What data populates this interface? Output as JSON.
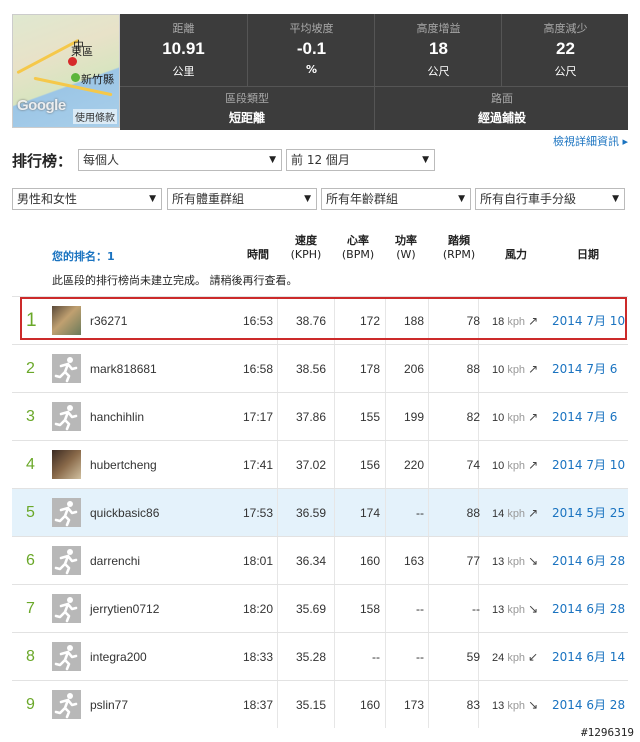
{
  "map": {
    "city1": "東區",
    "city2": "新竹縣",
    "edge_label": "中",
    "brand": "Google",
    "terms": "使用條款"
  },
  "stats": {
    "distance": {
      "label": "距離",
      "value": "10.91",
      "unit": "公里"
    },
    "grade": {
      "label": "平均坡度",
      "value": "-0.1",
      "unit": "%"
    },
    "gain": {
      "label": "高度增益",
      "value": "18",
      "unit": "公尺"
    },
    "loss": {
      "label": "高度減少",
      "value": "22",
      "unit": "公尺"
    },
    "type": {
      "label": "區段類型",
      "value": "短距離"
    },
    "surface": {
      "label": "路面",
      "value": "經過鋪設"
    }
  },
  "detail_link": "檢視詳細資訊 ▸",
  "leaderboard": {
    "title": "排行榜：",
    "filter_who": "每個人",
    "filter_period": "前 12 個月",
    "filter_gender": "男性和女性",
    "filter_weight": "所有體重群組",
    "filter_age": "所有年齡群組",
    "filter_class": "所有自行車手分級"
  },
  "table": {
    "your_rank": "您的排名：1",
    "note": "此區段的排行榜尚未建立完成。 請稍後再行查看。",
    "headers": {
      "time": "時間",
      "speed": "速度",
      "speed_unit": "(KPH)",
      "hr": "心率",
      "hr_unit": "(BPM)",
      "power": "功率",
      "power_unit": "(W)",
      "cadence": "踏頻",
      "cadence_unit": "(RPM)",
      "wind": "風力",
      "date": "日期"
    },
    "rows": [
      {
        "rank": "1",
        "name": "r36271",
        "time": "16:53",
        "speed": "38.76",
        "hr": "172",
        "power": "188",
        "cadence": "78",
        "wind": "18",
        "wind_unit": "kph",
        "wind_dir": "↗",
        "date": "2014 7月 10"
      },
      {
        "rank": "2",
        "name": "mark818681",
        "time": "16:58",
        "speed": "38.56",
        "hr": "178",
        "power": "206",
        "cadence": "88",
        "wind": "10",
        "wind_unit": "kph",
        "wind_dir": "↗",
        "date": "2014 7月 6"
      },
      {
        "rank": "3",
        "name": "hanchihlin",
        "time": "17:17",
        "speed": "37.86",
        "hr": "155",
        "power": "199",
        "cadence": "82",
        "wind": "10",
        "wind_unit": "kph",
        "wind_dir": "↗",
        "date": "2014 7月 6"
      },
      {
        "rank": "4",
        "name": "hubertcheng",
        "time": "17:41",
        "speed": "37.02",
        "hr": "156",
        "power": "220",
        "cadence": "74",
        "wind": "10",
        "wind_unit": "kph",
        "wind_dir": "↗",
        "date": "2014 7月 10"
      },
      {
        "rank": "5",
        "name": "quickbasic86",
        "time": "17:53",
        "speed": "36.59",
        "hr": "174",
        "power": "--",
        "cadence": "88",
        "wind": "14",
        "wind_unit": "kph",
        "wind_dir": "↗",
        "date": "2014 5月 25"
      },
      {
        "rank": "6",
        "name": "darrenchi",
        "time": "18:01",
        "speed": "36.34",
        "hr": "160",
        "power": "163",
        "cadence": "77",
        "wind": "13",
        "wind_unit": "kph",
        "wind_dir": "↘",
        "date": "2014 6月 28"
      },
      {
        "rank": "7",
        "name": "jerrytien0712",
        "time": "18:20",
        "speed": "35.69",
        "hr": "158",
        "power": "--",
        "cadence": "--",
        "wind": "13",
        "wind_unit": "kph",
        "wind_dir": "↘",
        "date": "2014 6月 28"
      },
      {
        "rank": "8",
        "name": "integra200",
        "time": "18:33",
        "speed": "35.28",
        "hr": "--",
        "power": "--",
        "cadence": "59",
        "wind": "24",
        "wind_unit": "kph",
        "wind_dir": "↙",
        "date": "2014 6月 14"
      },
      {
        "rank": "9",
        "name": "pslin77",
        "time": "18:37",
        "speed": "35.15",
        "hr": "160",
        "power": "173",
        "cadence": "83",
        "wind": "13",
        "wind_unit": "kph",
        "wind_dir": "↘",
        "date": "2014 6月 28"
      }
    ]
  },
  "watermark": "#1296319",
  "colors": {
    "rank_green": "#6aa829",
    "link_blue": "#1a73c0",
    "highlight_row": "#e4f2fb",
    "highlight_border": "#cc2a2a",
    "stats_bg": "#3c3c3c"
  }
}
